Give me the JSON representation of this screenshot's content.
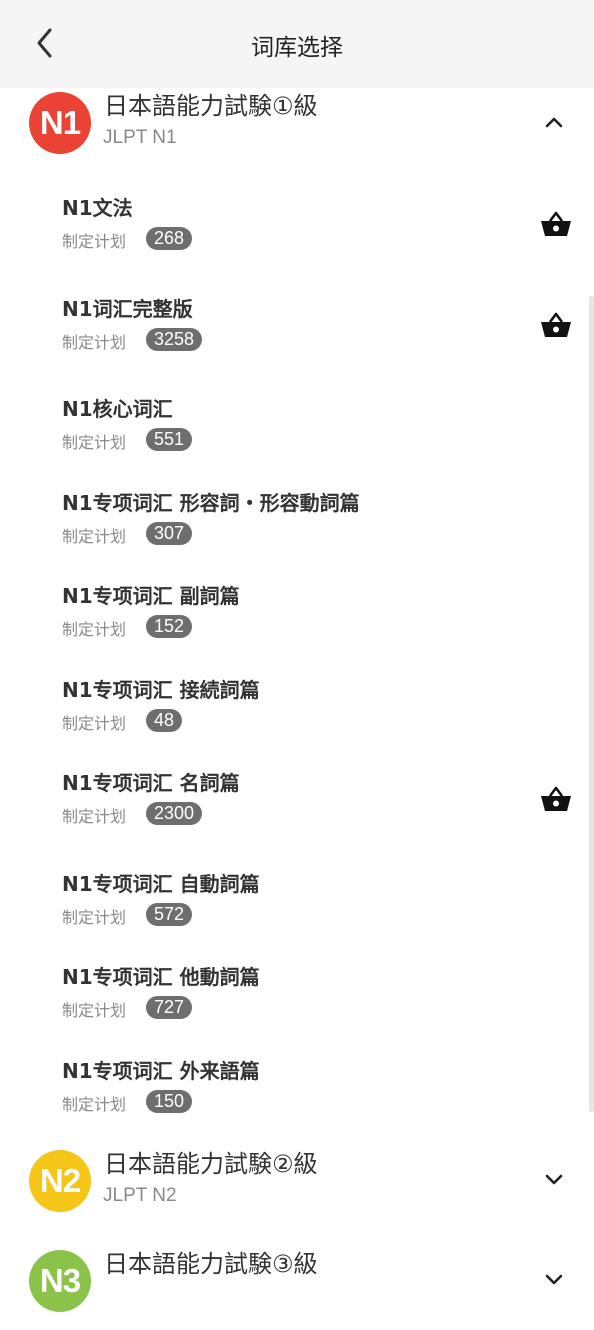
{
  "header": {
    "title": "词库选择",
    "back_icon": "chevron-left-icon"
  },
  "colors": {
    "n1": "#ea4335",
    "n2": "#f5c518",
    "n3": "#8bc34a",
    "count_pill": "#6e6e6e",
    "topbar_bg": "#f5f5f5"
  },
  "groups": [
    {
      "badge": "N1",
      "title": "日本語能力試験①級",
      "subtitle": "JLPT N1",
      "expanded": true,
      "chevron": "chevron-up-icon"
    },
    {
      "badge": "N2",
      "title": "日本語能力試験②級",
      "subtitle": "JLPT N2",
      "expanded": false,
      "chevron": "chevron-down-icon"
    },
    {
      "badge": "N3",
      "title": "日本語能力試験③級",
      "subtitle": "",
      "expanded": false,
      "chevron": "chevron-down-icon"
    }
  ],
  "items": [
    {
      "title": "N1文法",
      "plan": "制定计划",
      "count": "268",
      "basket": true
    },
    {
      "title": "N1词汇完整版",
      "plan": "制定计划",
      "count": "3258",
      "basket": true
    },
    {
      "title": "N1核心词汇",
      "plan": "制定计划",
      "count": "551",
      "basket": false
    },
    {
      "title": "N1专项词汇 形容詞・形容動詞篇",
      "plan": "制定计划",
      "count": "307",
      "basket": false
    },
    {
      "title": "N1专项词汇 副詞篇",
      "plan": "制定计划",
      "count": "152",
      "basket": false
    },
    {
      "title": "N1专项词汇 接続詞篇",
      "plan": "制定计划",
      "count": "48",
      "basket": false
    },
    {
      "title": "N1专项词汇 名詞篇",
      "plan": "制定计划",
      "count": "2300",
      "basket": true
    },
    {
      "title": "N1专项词汇 自動詞篇",
      "plan": "制定计划",
      "count": "572",
      "basket": false
    },
    {
      "title": "N1专项词汇 他動詞篇",
      "plan": "制定计划",
      "count": "727",
      "basket": false
    },
    {
      "title": "N1专项词汇 外来語篇",
      "plan": "制定计划",
      "count": "150",
      "basket": false
    }
  ]
}
